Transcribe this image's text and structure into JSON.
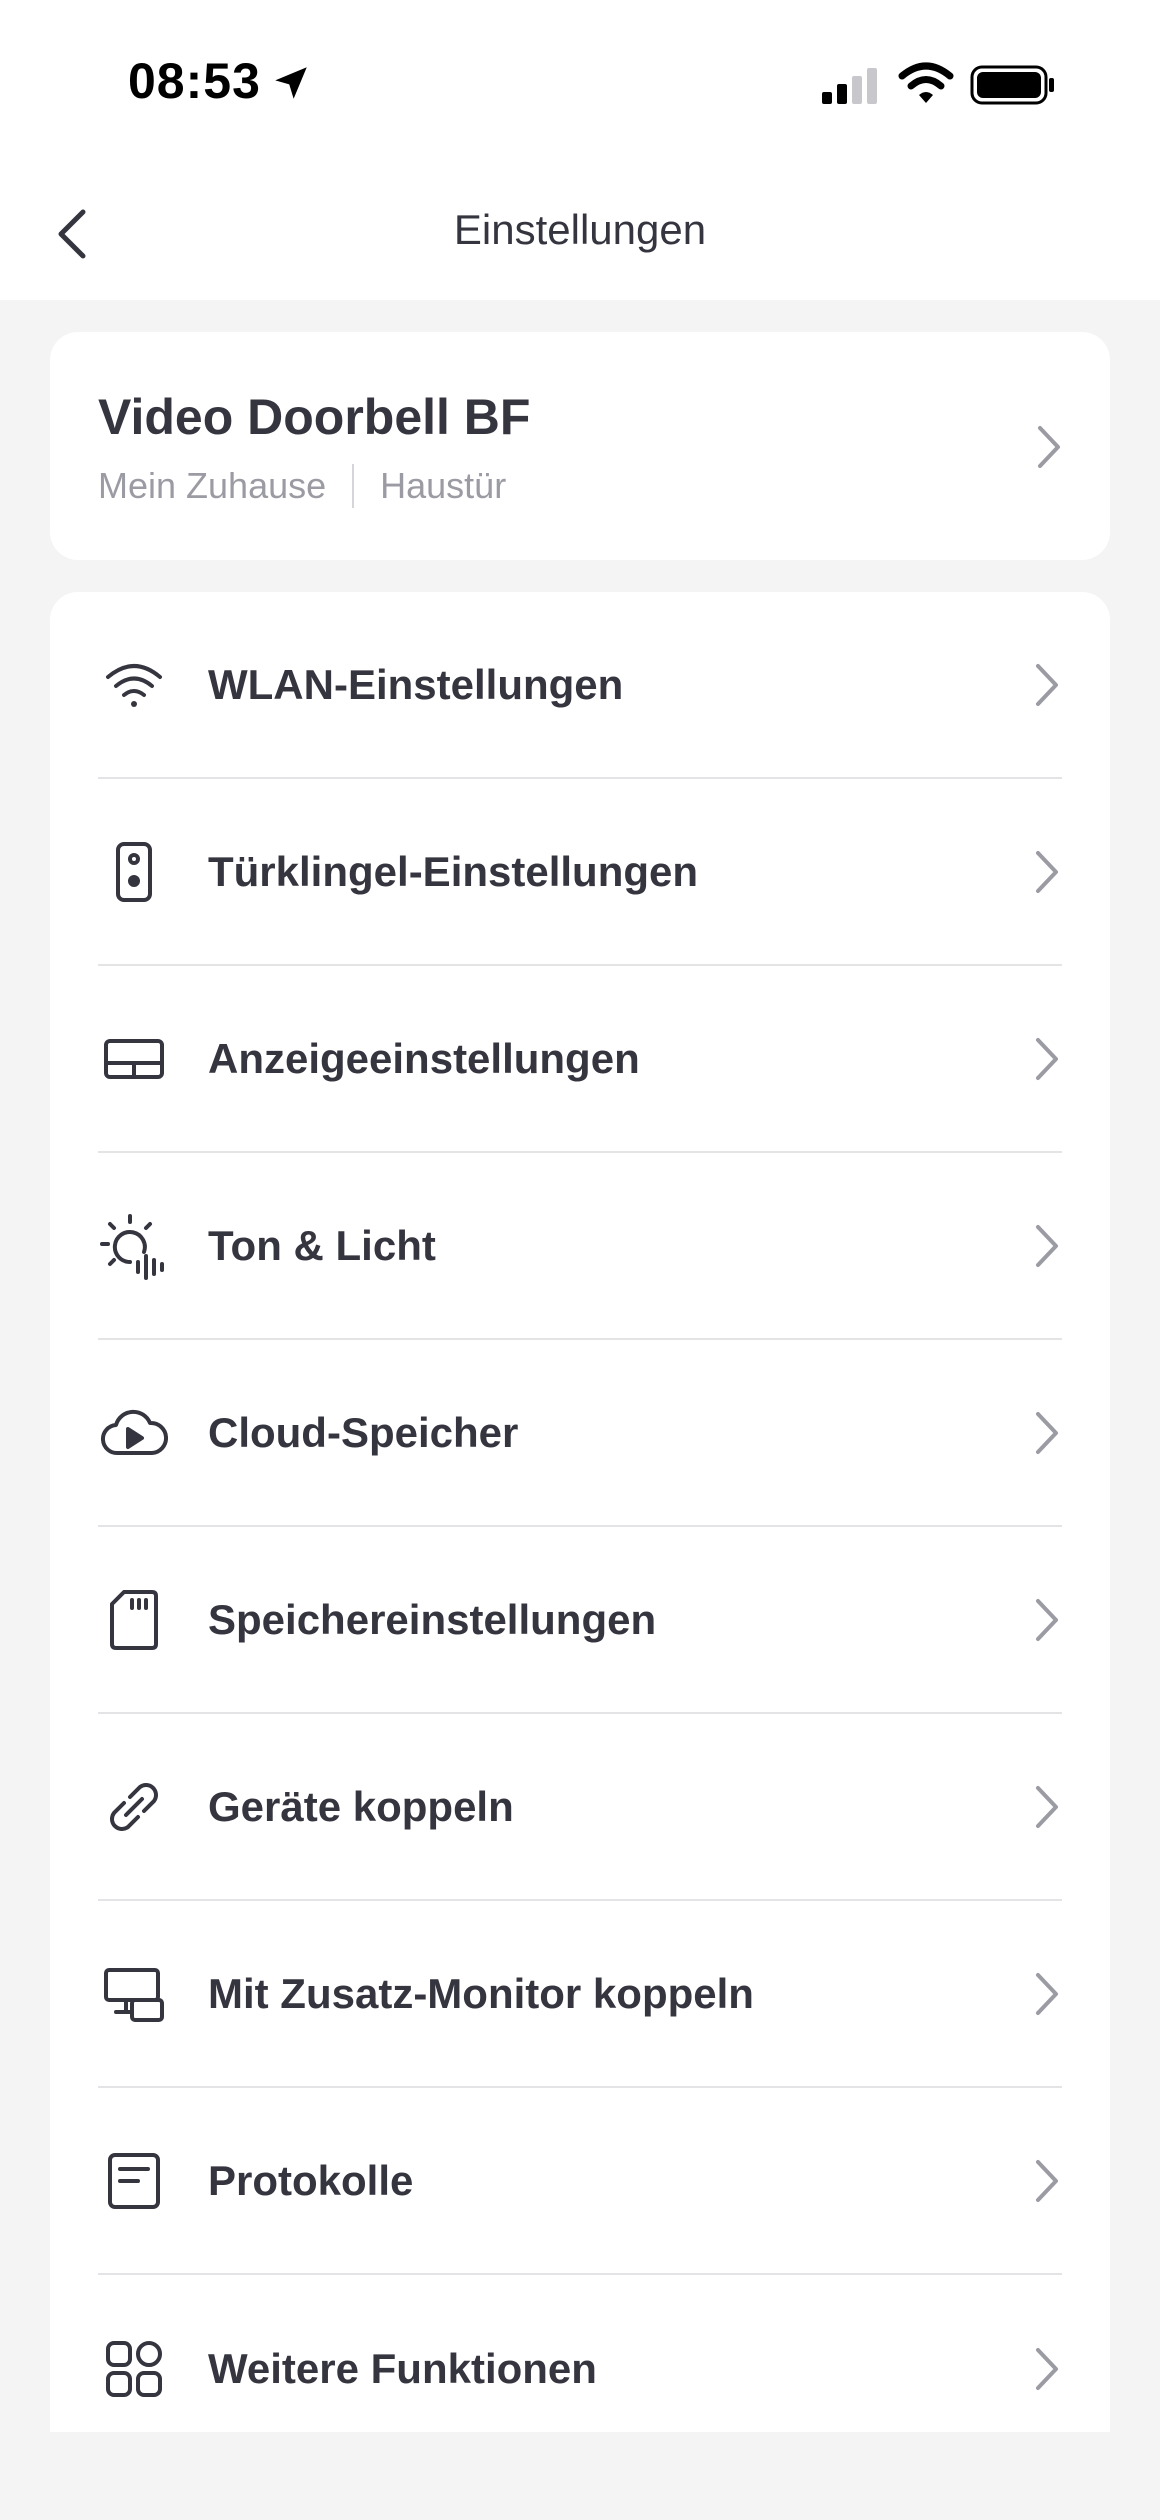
{
  "status_bar": {
    "time": "08:53"
  },
  "nav": {
    "title": "Einstellungen"
  },
  "device": {
    "name": "Video Doorbell BF",
    "home": "Mein Zuhause",
    "location": "Haustür"
  },
  "settings": {
    "items": [
      {
        "label": "WLAN-Einstellungen",
        "icon": "wifi-icon"
      },
      {
        "label": "Türklingel-Einstellungen",
        "icon": "doorbell-icon"
      },
      {
        "label": "Anzeigeeinstellungen",
        "icon": "display-icon"
      },
      {
        "label": "Ton & Licht",
        "icon": "sound-light-icon"
      },
      {
        "label": "Cloud-Speicher",
        "icon": "cloud-play-icon"
      },
      {
        "label": "Speichereinstellungen",
        "icon": "sd-card-icon"
      },
      {
        "label": "Geräte koppeln",
        "icon": "link-icon"
      },
      {
        "label": "Mit Zusatz-Monitor koppeln",
        "icon": "monitor-pair-icon"
      },
      {
        "label": "Protokolle",
        "icon": "log-icon"
      },
      {
        "label": "Weitere Funktionen",
        "icon": "grid-icon"
      }
    ]
  }
}
